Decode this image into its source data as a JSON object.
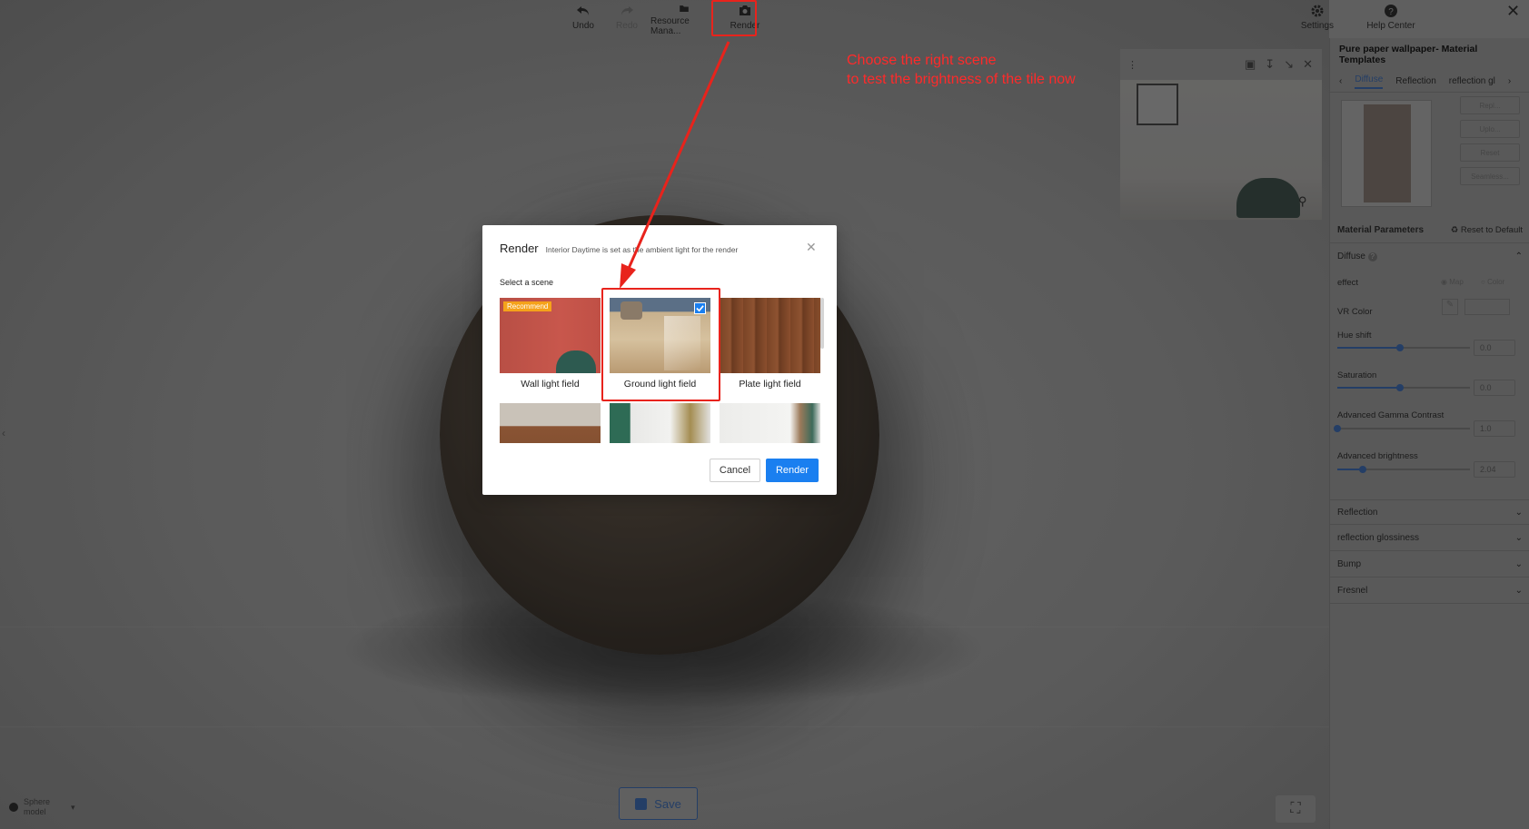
{
  "toolbar": {
    "undo": "Undo",
    "redo": "Redo",
    "resource": "Resource Mana...",
    "render": "Render",
    "settings": "Settings",
    "help": "Help Center"
  },
  "annotation": {
    "line1": "Choose the right scene",
    "line2": "to test the brightness of the tile now"
  },
  "panel": {
    "title": "Pure paper wallpaper- Material Templates",
    "tabs": [
      "Diffuse",
      "Reflection",
      "reflection gl"
    ],
    "buttons": [
      "Repl...",
      "Uplo...",
      "Reset",
      "Seamless..."
    ],
    "params_title": "Material Parameters",
    "reset_default": "Reset to Default",
    "diffuse": "Diffuse",
    "effect": "effect",
    "effect_map": "Map",
    "effect_color": "Color",
    "vr_color": "VR Color",
    "hue_shift": {
      "label": "Hue shift",
      "value": "0.0",
      "fraction": 0.47
    },
    "saturation": {
      "label": "Saturation",
      "value": "0.0",
      "fraction": 0.47
    },
    "gamma": {
      "label": "Advanced Gamma Contrast",
      "value": "1.0",
      "fraction": 0.0
    },
    "brightness": {
      "label": "Advanced brightness",
      "value": "2.04",
      "fraction": 0.19
    },
    "sections": [
      "Reflection",
      "reflection glossiness",
      "Bump",
      "Fresnel"
    ]
  },
  "modal": {
    "title": "Render",
    "subtitle": "Interior Daytime is set as the ambient light for the render",
    "select_label": "Select a scene",
    "scenes": [
      {
        "label": "Wall light field",
        "badge": "Recommend",
        "selected": false
      },
      {
        "label": "Ground light field",
        "selected": true
      },
      {
        "label": "Plate light field",
        "selected": false
      }
    ],
    "cancel": "Cancel",
    "render": "Render"
  },
  "bottom": {
    "model": "Sphere model",
    "save": "Save"
  },
  "colors": {
    "accent": "#1a7ff0",
    "highlight": "#e8231c",
    "badge": "#f5a21a"
  }
}
